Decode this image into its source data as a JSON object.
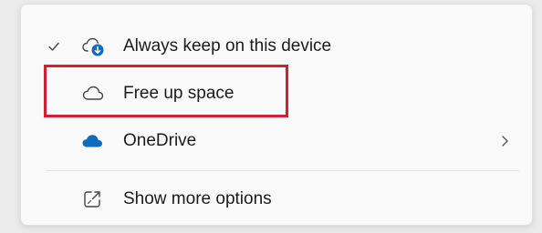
{
  "context_menu": {
    "items": [
      {
        "label": "Always keep on this device",
        "checked": true,
        "icon": "cloud-download-icon"
      },
      {
        "label": "Free up space",
        "checked": false,
        "icon": "cloud-outline-icon",
        "highlighted": true
      },
      {
        "label": "OneDrive",
        "checked": false,
        "icon": "onedrive-cloud-icon",
        "has_submenu": true
      },
      {
        "label": "Show more options",
        "checked": false,
        "icon": "show-more-options-icon"
      }
    ]
  },
  "colors": {
    "onedrive_blue": "#0f6cbd",
    "highlight_red": "#d3202f",
    "menu_background": "#f9f9f9"
  }
}
